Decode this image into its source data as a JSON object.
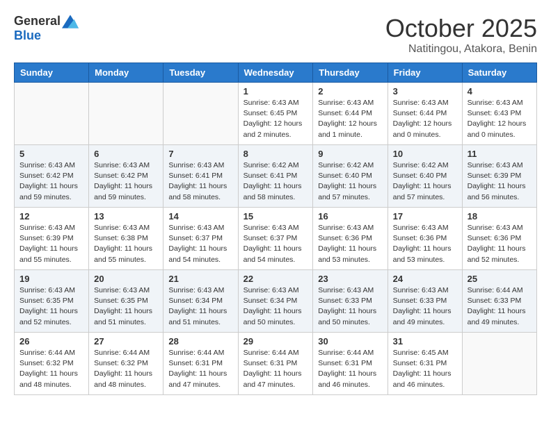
{
  "header": {
    "logo_general": "General",
    "logo_blue": "Blue",
    "month_title": "October 2025",
    "location": "Natitingou, Atakora, Benin"
  },
  "weekdays": [
    "Sunday",
    "Monday",
    "Tuesday",
    "Wednesday",
    "Thursday",
    "Friday",
    "Saturday"
  ],
  "weeks": [
    [
      {
        "day": "",
        "info": ""
      },
      {
        "day": "",
        "info": ""
      },
      {
        "day": "",
        "info": ""
      },
      {
        "day": "1",
        "info": "Sunrise: 6:43 AM\nSunset: 6:45 PM\nDaylight: 12 hours\nand 2 minutes."
      },
      {
        "day": "2",
        "info": "Sunrise: 6:43 AM\nSunset: 6:44 PM\nDaylight: 12 hours\nand 1 minute."
      },
      {
        "day": "3",
        "info": "Sunrise: 6:43 AM\nSunset: 6:44 PM\nDaylight: 12 hours\nand 0 minutes."
      },
      {
        "day": "4",
        "info": "Sunrise: 6:43 AM\nSunset: 6:43 PM\nDaylight: 12 hours\nand 0 minutes."
      }
    ],
    [
      {
        "day": "5",
        "info": "Sunrise: 6:43 AM\nSunset: 6:42 PM\nDaylight: 11 hours\nand 59 minutes."
      },
      {
        "day": "6",
        "info": "Sunrise: 6:43 AM\nSunset: 6:42 PM\nDaylight: 11 hours\nand 59 minutes."
      },
      {
        "day": "7",
        "info": "Sunrise: 6:43 AM\nSunset: 6:41 PM\nDaylight: 11 hours\nand 58 minutes."
      },
      {
        "day": "8",
        "info": "Sunrise: 6:42 AM\nSunset: 6:41 PM\nDaylight: 11 hours\nand 58 minutes."
      },
      {
        "day": "9",
        "info": "Sunrise: 6:42 AM\nSunset: 6:40 PM\nDaylight: 11 hours\nand 57 minutes."
      },
      {
        "day": "10",
        "info": "Sunrise: 6:42 AM\nSunset: 6:40 PM\nDaylight: 11 hours\nand 57 minutes."
      },
      {
        "day": "11",
        "info": "Sunrise: 6:43 AM\nSunset: 6:39 PM\nDaylight: 11 hours\nand 56 minutes."
      }
    ],
    [
      {
        "day": "12",
        "info": "Sunrise: 6:43 AM\nSunset: 6:39 PM\nDaylight: 11 hours\nand 55 minutes."
      },
      {
        "day": "13",
        "info": "Sunrise: 6:43 AM\nSunset: 6:38 PM\nDaylight: 11 hours\nand 55 minutes."
      },
      {
        "day": "14",
        "info": "Sunrise: 6:43 AM\nSunset: 6:37 PM\nDaylight: 11 hours\nand 54 minutes."
      },
      {
        "day": "15",
        "info": "Sunrise: 6:43 AM\nSunset: 6:37 PM\nDaylight: 11 hours\nand 54 minutes."
      },
      {
        "day": "16",
        "info": "Sunrise: 6:43 AM\nSunset: 6:36 PM\nDaylight: 11 hours\nand 53 minutes."
      },
      {
        "day": "17",
        "info": "Sunrise: 6:43 AM\nSunset: 6:36 PM\nDaylight: 11 hours\nand 53 minutes."
      },
      {
        "day": "18",
        "info": "Sunrise: 6:43 AM\nSunset: 6:36 PM\nDaylight: 11 hours\nand 52 minutes."
      }
    ],
    [
      {
        "day": "19",
        "info": "Sunrise: 6:43 AM\nSunset: 6:35 PM\nDaylight: 11 hours\nand 52 minutes."
      },
      {
        "day": "20",
        "info": "Sunrise: 6:43 AM\nSunset: 6:35 PM\nDaylight: 11 hours\nand 51 minutes."
      },
      {
        "day": "21",
        "info": "Sunrise: 6:43 AM\nSunset: 6:34 PM\nDaylight: 11 hours\nand 51 minutes."
      },
      {
        "day": "22",
        "info": "Sunrise: 6:43 AM\nSunset: 6:34 PM\nDaylight: 11 hours\nand 50 minutes."
      },
      {
        "day": "23",
        "info": "Sunrise: 6:43 AM\nSunset: 6:33 PM\nDaylight: 11 hours\nand 50 minutes."
      },
      {
        "day": "24",
        "info": "Sunrise: 6:43 AM\nSunset: 6:33 PM\nDaylight: 11 hours\nand 49 minutes."
      },
      {
        "day": "25",
        "info": "Sunrise: 6:44 AM\nSunset: 6:33 PM\nDaylight: 11 hours\nand 49 minutes."
      }
    ],
    [
      {
        "day": "26",
        "info": "Sunrise: 6:44 AM\nSunset: 6:32 PM\nDaylight: 11 hours\nand 48 minutes."
      },
      {
        "day": "27",
        "info": "Sunrise: 6:44 AM\nSunset: 6:32 PM\nDaylight: 11 hours\nand 48 minutes."
      },
      {
        "day": "28",
        "info": "Sunrise: 6:44 AM\nSunset: 6:31 PM\nDaylight: 11 hours\nand 47 minutes."
      },
      {
        "day": "29",
        "info": "Sunrise: 6:44 AM\nSunset: 6:31 PM\nDaylight: 11 hours\nand 47 minutes."
      },
      {
        "day": "30",
        "info": "Sunrise: 6:44 AM\nSunset: 6:31 PM\nDaylight: 11 hours\nand 46 minutes."
      },
      {
        "day": "31",
        "info": "Sunrise: 6:45 AM\nSunset: 6:31 PM\nDaylight: 11 hours\nand 46 minutes."
      },
      {
        "day": "",
        "info": ""
      }
    ]
  ]
}
